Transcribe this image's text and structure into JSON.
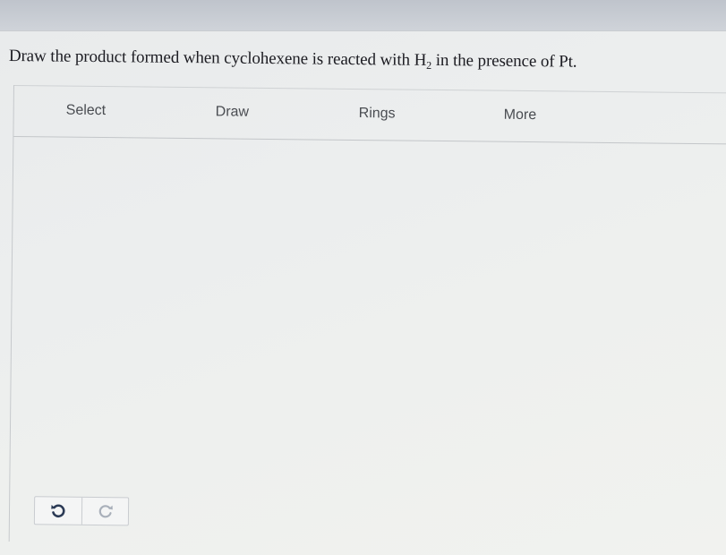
{
  "question": {
    "prefix": "Draw the product formed when cyclohexene is reacted with H",
    "subscript": "2",
    "suffix": " in the presence of Pt."
  },
  "toolbar": {
    "select_label": "Select",
    "draw_label": "Draw",
    "rings_label": "Rings",
    "more_label": "More"
  },
  "controls": {
    "undo_icon": "undo-icon",
    "redo_icon": "redo-icon",
    "undo_color": "#2b3a55",
    "redo_color": "#a9b0ba"
  }
}
